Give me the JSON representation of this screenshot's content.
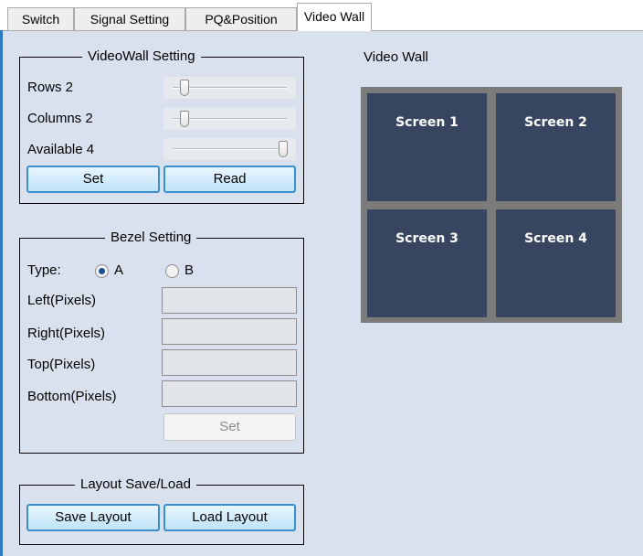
{
  "tabs": [
    {
      "label": "Switch",
      "active": false
    },
    {
      "label": "Signal Setting",
      "active": false
    },
    {
      "label": "PQ&Position",
      "active": false
    },
    {
      "label": "Video Wall",
      "active": true
    }
  ],
  "videowall_setting": {
    "title": "VideoWall Setting",
    "rows_label": "Rows 2",
    "rows_value": 2,
    "columns_label": "Columns 2",
    "columns_value": 2,
    "available_label": "Available 4",
    "available_value": 4,
    "set_label": "Set",
    "read_label": "Read"
  },
  "bezel_setting": {
    "title": "Bezel Setting",
    "type_label": "Type:",
    "option_a": "A",
    "option_b": "B",
    "selected": "A",
    "left_label": "Left(Pixels)",
    "right_label": "Right(Pixels)",
    "top_label": "Top(Pixels)",
    "bottom_label": "Bottom(Pixels)",
    "left_value": "",
    "right_value": "",
    "top_value": "",
    "bottom_value": "",
    "set_label": "Set"
  },
  "layout_save_load": {
    "title": "Layout Save/Load",
    "save_label": "Save Layout",
    "load_label": "Load Layout"
  },
  "video_wall": {
    "title": "Video Wall",
    "screens": [
      "Screen 1",
      "Screen 2",
      "Screen 3",
      "Screen 4"
    ]
  },
  "colors": {
    "background": "#d9e1ee",
    "screen": "#374560",
    "wall_frame": "#7b7b7b",
    "button_border": "#3a8fd1",
    "accent_edge": "#2f78c4"
  }
}
